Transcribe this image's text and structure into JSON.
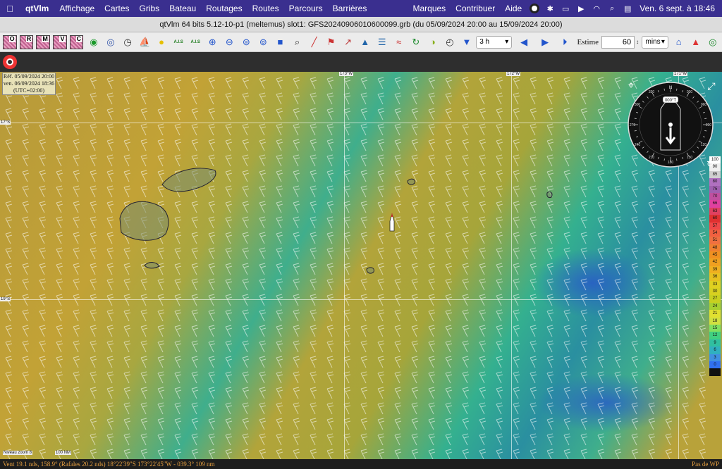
{
  "menubar": {
    "app_name": "qtVlm",
    "items": [
      "Affichage",
      "Cartes",
      "Gribs",
      "Bateau",
      "Routages",
      "Routes",
      "Parcours",
      "Barrières"
    ],
    "right_items": [
      "Marques",
      "Contribuer",
      "Aide"
    ],
    "clock": "Ven. 6 sept. à  18:46"
  },
  "window": {
    "title": "qtVlm 64 bits 5.12-10-p1 (meltemus) slot1: GFS20240906010600099.grb (du 05/09/2024 20:00 au 15/09/2024 20:00)"
  },
  "toolbar": {
    "grib_letters": [
      "O",
      "R",
      "M",
      "V",
      "C"
    ],
    "ais_label": "A.I.S",
    "step_value": "3 h",
    "estime_label": "Estime",
    "estime_value": "60",
    "estime_unit": "mins"
  },
  "ref_box": {
    "line1": "Réf. 05/09/2024 20:00",
    "line2": "ven. 06/09/2024 18:36",
    "line3": "(UTC+02:00)"
  },
  "compass": {
    "heading_label": "000°T",
    "ticks": [
      "330",
      "030",
      "300",
      "060",
      "270",
      "090",
      "240",
      "120",
      "210",
      "150",
      "180"
    ],
    "north": "N"
  },
  "scale": {
    "values": [
      "100",
      "90",
      "85",
      "80",
      "75",
      "70",
      "66",
      "63",
      "60",
      "57",
      "54",
      "51",
      "48",
      "45",
      "42",
      "39",
      "36",
      "33",
      "30",
      "27",
      "24",
      "21",
      "18",
      "15",
      "12",
      "9",
      "6",
      "3",
      "0"
    ],
    "colors": [
      "#ffffff",
      "#f0f0f0",
      "#d0d0d0",
      "#b070c0",
      "#a060b0",
      "#c050a0",
      "#e040a0",
      "#e04060",
      "#e03030",
      "#f04848",
      "#f06040",
      "#f07040",
      "#f08030",
      "#f09020",
      "#f0a020",
      "#f0b020",
      "#e8c020",
      "#e0d020",
      "#d8d020",
      "#c8d020",
      "#a8d030",
      "#e0e030",
      "#d0e040",
      "#80e060",
      "#40d080",
      "#30c0a0",
      "#30b0c0",
      "#4090e0",
      "#3070f0"
    ]
  },
  "grid_labels": {
    "top1": "173°W",
    "top2": "172°W",
    "top3": "171°W",
    "left1": "17°S",
    "left2": "19°S"
  },
  "scalebar": {
    "label1": "Niveau zoom 8",
    "label2": "100 NM"
  },
  "status": {
    "left": "Vent 19.1 nds, 158.9° (Rafales 20.2 nds) 18°22'39\"S 173°22'45\"W - 039.3° 109 nm",
    "right": "Pas de WP"
  }
}
